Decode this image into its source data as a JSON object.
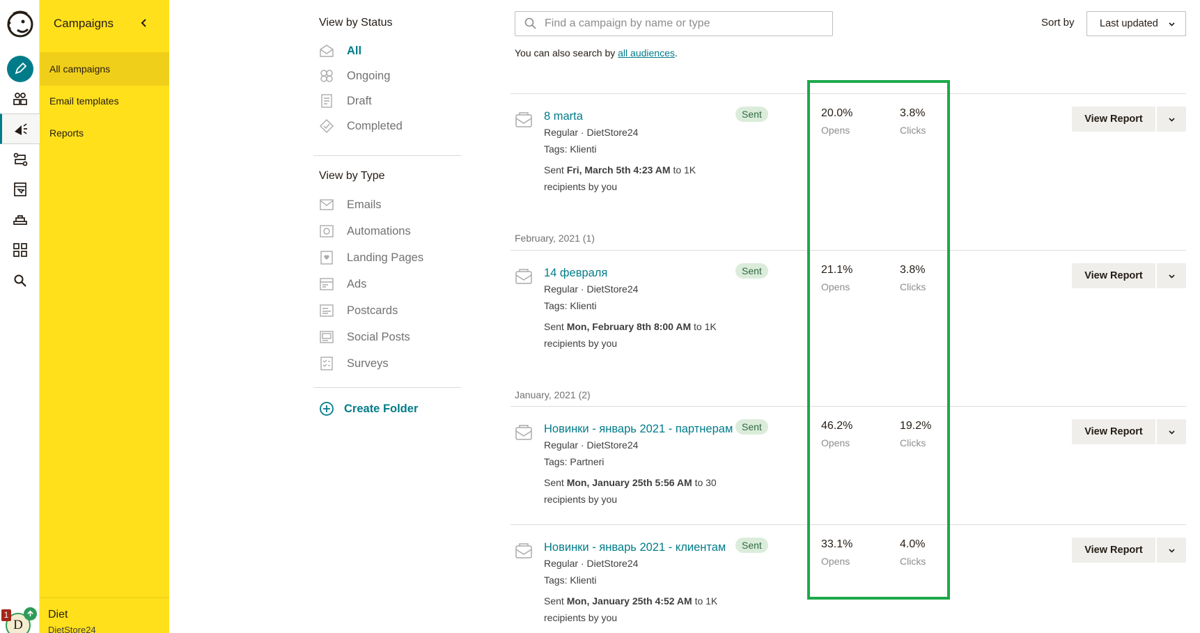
{
  "sidebar": {
    "title": "Campaigns",
    "items": [
      {
        "label": "All campaigns"
      },
      {
        "label": "Email templates"
      },
      {
        "label": "Reports"
      }
    ],
    "account": {
      "name": "Diet",
      "org": "DietStore24",
      "avatar_letter": "D",
      "notification_count": "1"
    }
  },
  "rail": {
    "icons": [
      "freddie-logo-icon",
      "create-pencil-icon",
      "audience-icon",
      "campaigns-megaphone-icon",
      "automations-icon",
      "website-icon",
      "content-studio-icon",
      "integrations-icon",
      "search-icon"
    ]
  },
  "filters": {
    "status_heading": "View by Status",
    "status": [
      {
        "label": "All",
        "icon": "envelope-open-icon",
        "active": true
      },
      {
        "label": "Ongoing",
        "icon": "ongoing-icon",
        "active": false
      },
      {
        "label": "Draft",
        "icon": "draft-icon",
        "active": false
      },
      {
        "label": "Completed",
        "icon": "completed-check-icon",
        "active": false
      }
    ],
    "type_heading": "View by Type",
    "types": [
      {
        "label": "Emails",
        "icon": "email-icon"
      },
      {
        "label": "Automations",
        "icon": "automation-icon"
      },
      {
        "label": "Landing Pages",
        "icon": "landing-page-icon"
      },
      {
        "label": "Ads",
        "icon": "ads-icon"
      },
      {
        "label": "Postcards",
        "icon": "postcard-icon"
      },
      {
        "label": "Social Posts",
        "icon": "social-post-icon"
      },
      {
        "label": "Surveys",
        "icon": "survey-icon"
      }
    ],
    "create_folder": "Create Folder"
  },
  "search": {
    "placeholder": "Find a campaign by name or type",
    "hint_prefix": "You can also search by ",
    "hint_link": "all audiences",
    "hint_suffix": "."
  },
  "sort": {
    "label": "Sort by",
    "value": "Last updated"
  },
  "groups": [
    {
      "label": "February, 2021 (1)"
    },
    {
      "label": "January, 2021 (2)"
    }
  ],
  "campaigns": [
    {
      "name": "8 marta",
      "type": "Regular · DietStore24",
      "tags": "Tags: Klienti",
      "sent_prefix": "Sent ",
      "sent_date": "Fri, March 5th 4:23 AM",
      "sent_suffix": " to 1K",
      "recipients": "recipients by you",
      "status": "Sent",
      "opens": "20.0%",
      "opens_label": "Opens",
      "clicks": "3.8%",
      "clicks_label": "Clicks",
      "action": "View Report"
    },
    {
      "name": "14 февраля",
      "type": "Regular · DietStore24",
      "tags": "Tags: Klienti",
      "sent_prefix": "Sent ",
      "sent_date": "Mon, February 8th 8:00 AM",
      "sent_suffix": " to 1K",
      "recipients": "recipients by you",
      "status": "Sent",
      "opens": "21.1%",
      "opens_label": "Opens",
      "clicks": "3.8%",
      "clicks_label": "Clicks",
      "action": "View Report"
    },
    {
      "name": "Новинки - январь 2021 - партнерам",
      "type": "Regular · DietStore24",
      "tags": "Tags: Partneri",
      "sent_prefix": "Sent ",
      "sent_date": "Mon, January 25th 5:56 AM",
      "sent_suffix": " to 30",
      "recipients": "recipients by you",
      "status": "Sent",
      "opens": "46.2%",
      "opens_label": "Opens",
      "clicks": "19.2%",
      "clicks_label": "Clicks",
      "action": "View Report"
    },
    {
      "name": "Новинки - январь 2021 - клиентам",
      "type": "Regular · DietStore24",
      "tags": "Tags: Klienti",
      "sent_prefix": "Sent ",
      "sent_date": "Mon, January 25th 4:52 AM",
      "sent_suffix": " to 1K",
      "recipients": "recipients by you",
      "status": "Sent",
      "opens": "33.1%",
      "opens_label": "Opens",
      "clicks": "4.0%",
      "clicks_label": "Clicks",
      "action": "View Report"
    }
  ],
  "colors": {
    "brand_yellow": "#ffe01b",
    "accent_teal": "#007c89",
    "highlight_green": "#1da84a",
    "sent_badge": "#dbecdb"
  }
}
